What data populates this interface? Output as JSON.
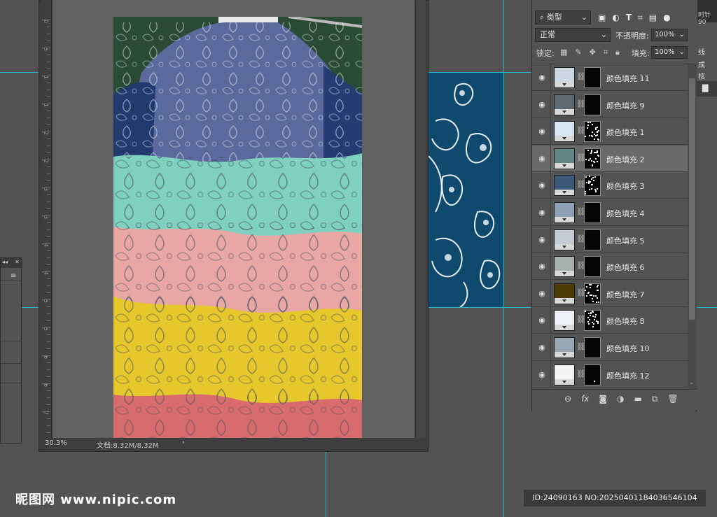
{
  "status_bar": {
    "zoom": "30.3%",
    "doc_info": "文档:8.32M/8.32M",
    "arrow": "›"
  },
  "ruler": {
    "labels": [
      "0",
      "5",
      "1",
      "1",
      "2",
      "2",
      "3",
      "3",
      "4",
      "4",
      "5",
      "5",
      "6",
      "6",
      "7"
    ]
  },
  "layers_panel": {
    "kind_filter": "类型",
    "blend_mode": "正常",
    "opacity_label": "不透明度:",
    "opacity_value": "100%",
    "lock_label": "锁定:",
    "fill_label": "填充:",
    "fill_value": "100%",
    "layers": [
      {
        "name": "颜色填充 11",
        "color": "#cdd8e3",
        "mask": "black",
        "selected": false
      },
      {
        "name": "颜色填充 9",
        "color": "#5e6a70",
        "mask": "black",
        "selected": false
      },
      {
        "name": "颜色填充 1",
        "color": "#d7e6f3",
        "mask": "speckled",
        "selected": false
      },
      {
        "name": "颜色填充 2",
        "color": "#5f8683",
        "mask": "speckled",
        "selected": true
      },
      {
        "name": "颜色填充 3",
        "color": "#3c587a",
        "mask": "speckled",
        "selected": false
      },
      {
        "name": "颜色填充 4",
        "color": "#8fa1b5",
        "mask": "black",
        "selected": false
      },
      {
        "name": "颜色填充 5",
        "color": "#c5ccd3",
        "mask": "black",
        "selected": false
      },
      {
        "name": "颜色填充 6",
        "color": "#a9b1ae",
        "mask": "black",
        "selected": false
      },
      {
        "name": "颜色填充 7",
        "color": "#4e3c06",
        "mask": "speckled",
        "selected": false
      },
      {
        "name": "颜色填充 8",
        "color": "#eef1f5",
        "mask": "speckled",
        "selected": false
      },
      {
        "name": "颜色填充 10",
        "color": "#9aa8b3",
        "mask": "black",
        "selected": false
      },
      {
        "name": "颜色填充 12",
        "color": "#f4f3f6",
        "mask": "dot",
        "selected": false
      }
    ],
    "bottom_icons": [
      "link-icon",
      "fx-icon",
      "mask-icon",
      "adjustment-icon",
      "folder-icon",
      "new-layer-icon",
      "trash-icon"
    ]
  },
  "right_strip": {
    "top_text": "时针 90",
    "items": [
      "线",
      "成",
      "核"
    ]
  },
  "watermark": {
    "left": "昵图网 www.nipic.com",
    "right": "ID:24090163 NO:20250401184036546104"
  },
  "colors": {
    "guide": "#27b4c9",
    "workspace": "#535353",
    "pattern_bg": "#0f4a6e"
  }
}
